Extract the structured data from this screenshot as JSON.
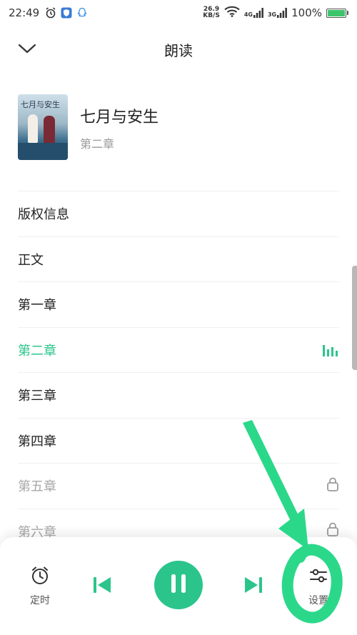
{
  "status_bar": {
    "time": "22:49",
    "net_speed_value": "26.9",
    "net_speed_unit": "KB/S",
    "sim1": "4G",
    "sim2": "3G",
    "battery": "100%",
    "battery_level": 1.0
  },
  "header": {
    "title": "朗读"
  },
  "book": {
    "title": "七月与安生",
    "subtitle": "第二章",
    "cover_text": "七月与安生"
  },
  "chapters": [
    {
      "label": "版权信息",
      "state": "normal"
    },
    {
      "label": "正文",
      "state": "normal"
    },
    {
      "label": "第一章",
      "state": "normal"
    },
    {
      "label": "第二章",
      "state": "active"
    },
    {
      "label": "第三章",
      "state": "normal"
    },
    {
      "label": "第四章",
      "state": "normal"
    },
    {
      "label": "第五章",
      "state": "locked"
    },
    {
      "label": "第六章",
      "state": "locked"
    }
  ],
  "player": {
    "timer_label": "定时",
    "settings_label": "设置"
  },
  "colors": {
    "accent": "#2bc58c",
    "locked": "#a8a8a8",
    "annotation": "#2bd88a"
  }
}
